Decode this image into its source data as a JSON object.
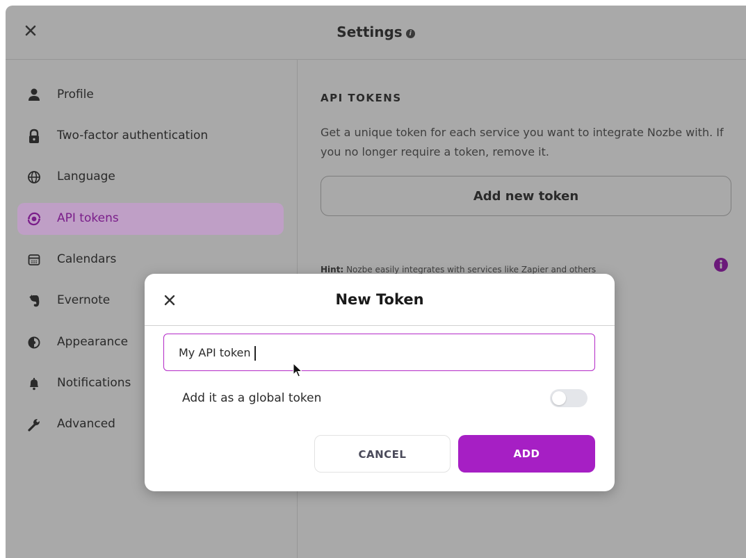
{
  "header": {
    "title": "Settings",
    "close_icon": "close-icon",
    "info_icon": "info-icon",
    "info_glyph": "i"
  },
  "sidebar": {
    "items": [
      {
        "label": "Profile",
        "icon": "user-icon"
      },
      {
        "label": "Two-factor authentication",
        "icon": "lock-icon"
      },
      {
        "label": "Language",
        "icon": "globe-icon"
      },
      {
        "label": "API tokens",
        "icon": "api-tokens-icon",
        "active": true
      },
      {
        "label": "Calendars",
        "icon": "calendar-icon"
      },
      {
        "label": "Evernote",
        "icon": "evernote-icon"
      },
      {
        "label": "Appearance",
        "icon": "appearance-icon"
      },
      {
        "label": "Notifications",
        "icon": "bell-icon"
      },
      {
        "label": "Advanced",
        "icon": "wrench-icon"
      }
    ]
  },
  "main": {
    "section_title": "API TOKENS",
    "description": "Get a unique token for each service you want to integrate Nozbe with. If you no longer require a token, remove it.",
    "add_button": "Add new token",
    "hint_label": "Hint:",
    "hint_text": "Nozbe easily integrates with services like Zapier and others"
  },
  "modal": {
    "title": "New Token",
    "input_value": "My API token",
    "toggle_label": "Add it as a global token",
    "toggle_on": false,
    "cancel_label": "CANCEL",
    "add_label": "ADD"
  },
  "colors": {
    "accent": "#a61fc4",
    "active_bg": "#bf9fc6",
    "active_text": "#7a1e8a",
    "overlay": "#a9a9a9"
  }
}
